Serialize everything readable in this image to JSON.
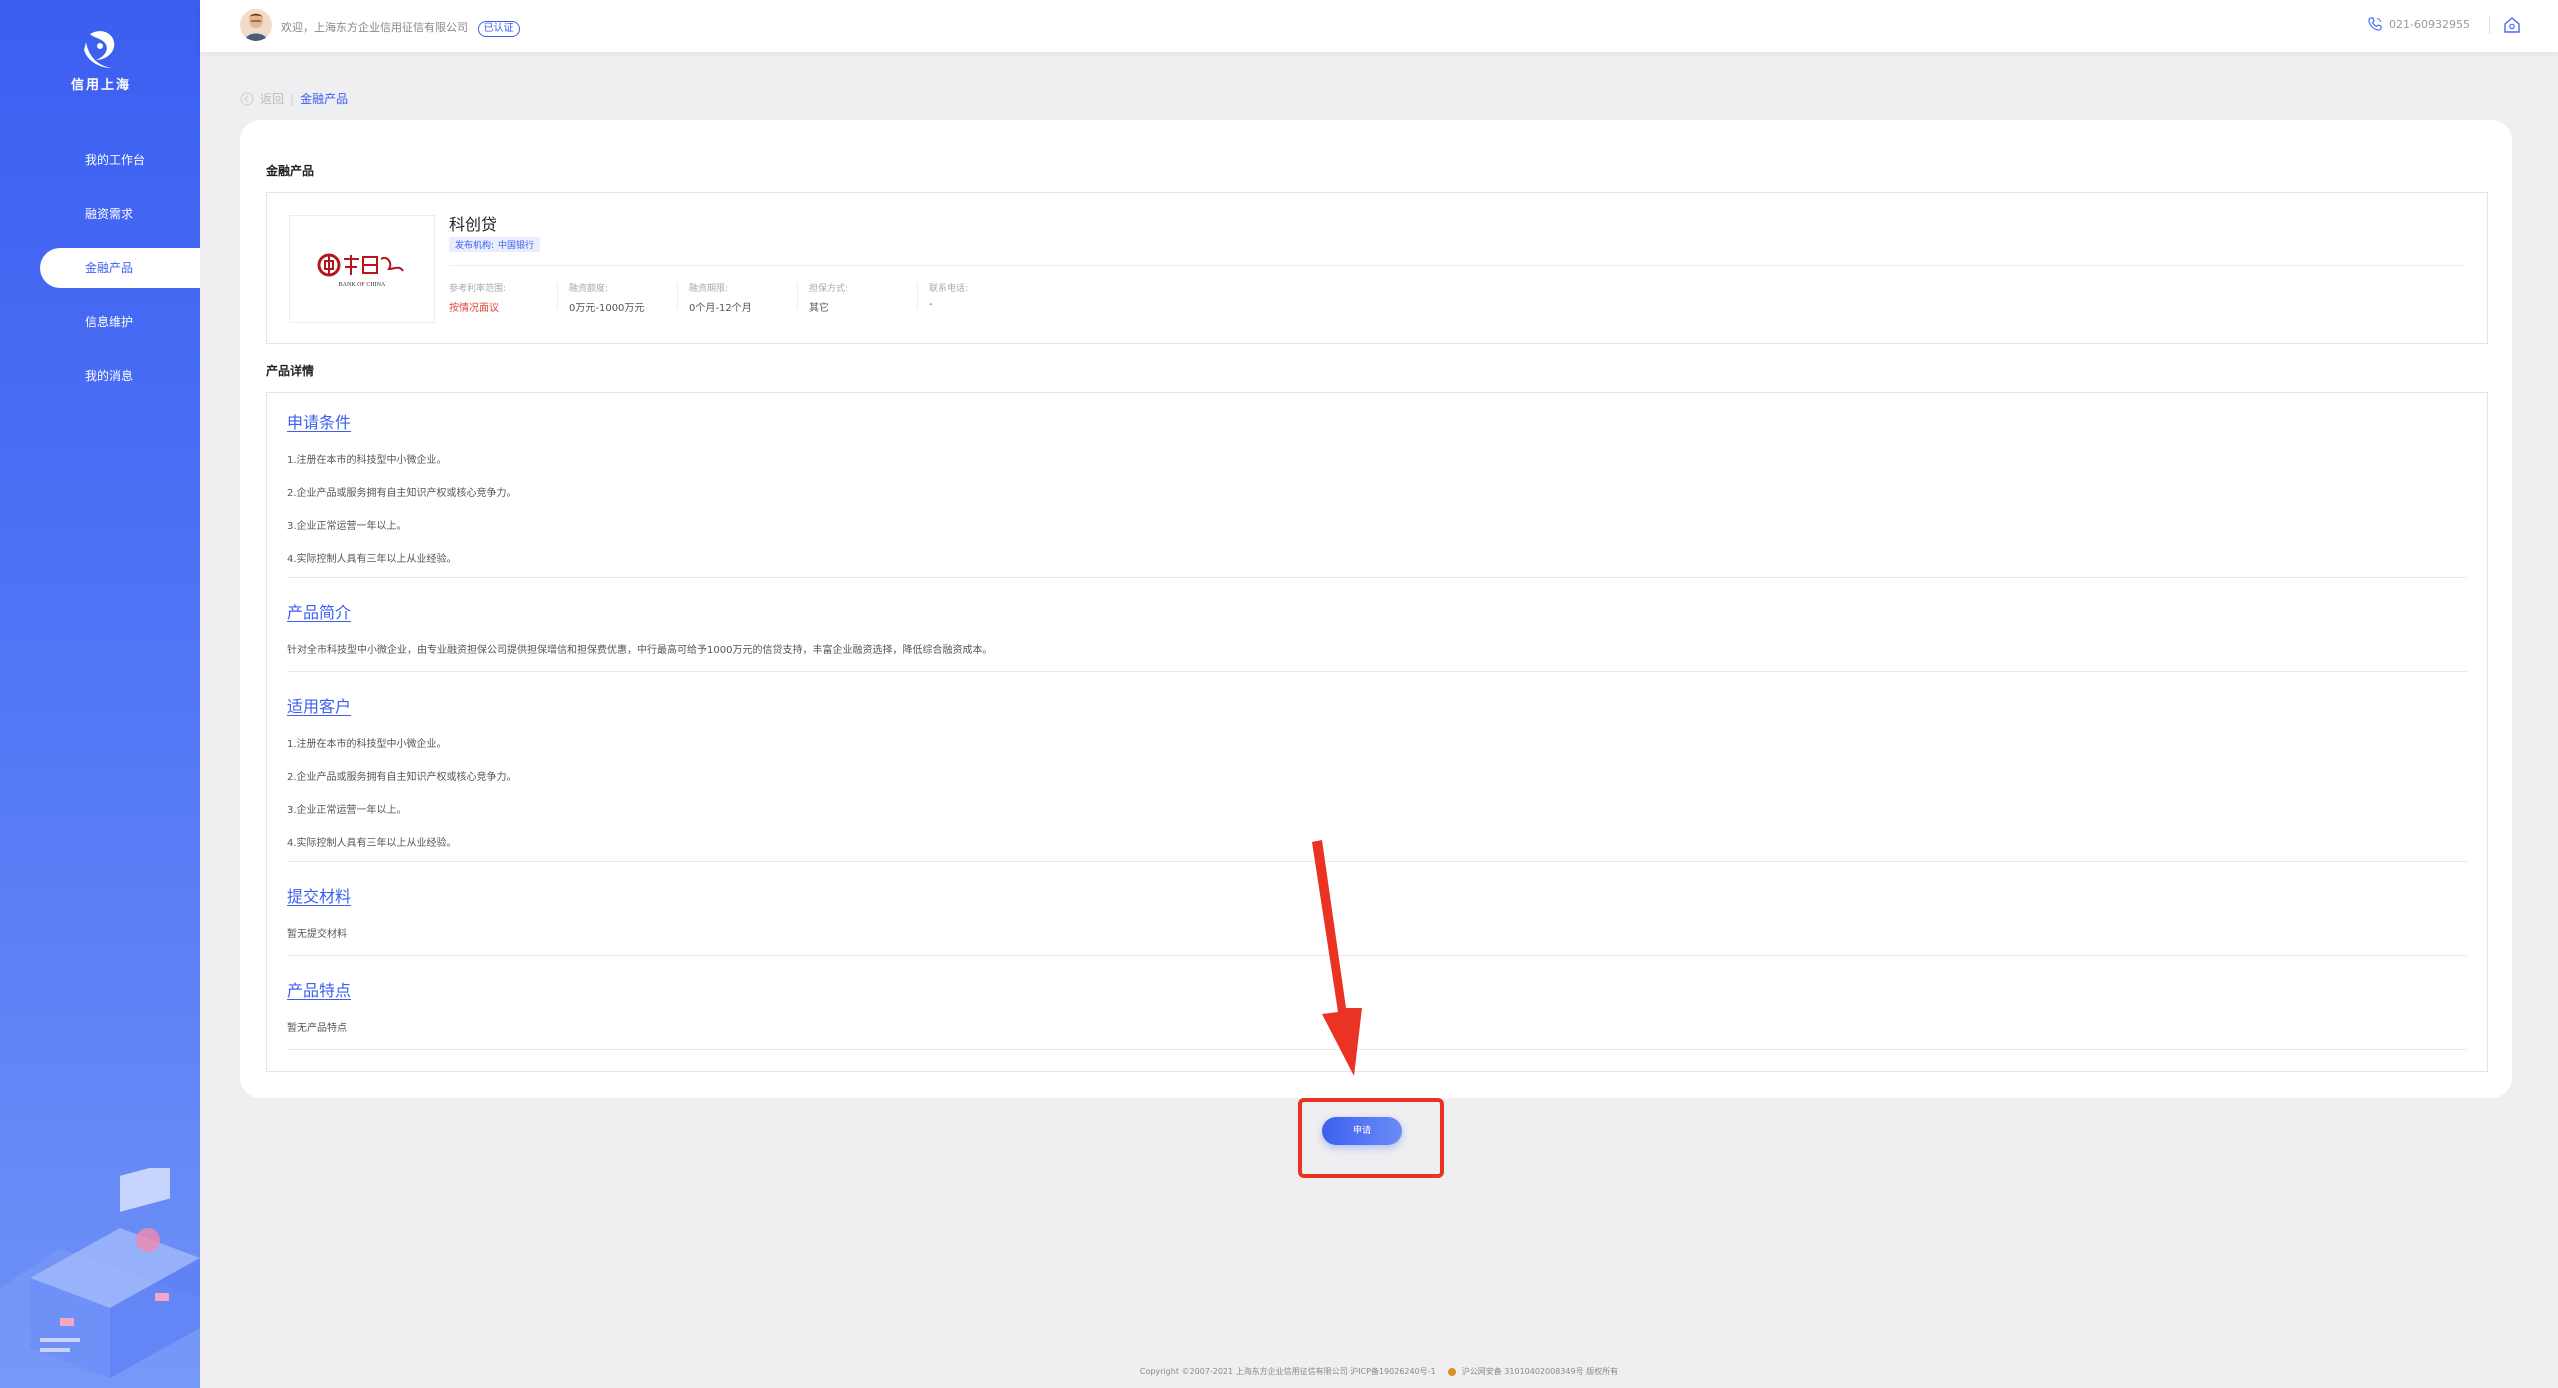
{
  "sidebar": {
    "logo_text": "信用上海",
    "items": [
      {
        "label": "我的工作台"
      },
      {
        "label": "融资需求"
      },
      {
        "label": "金融产品"
      },
      {
        "label": "信息维护"
      },
      {
        "label": "我的消息"
      }
    ]
  },
  "topbar": {
    "welcome": "欢迎，上海东方企业信用征信有限公司",
    "verify_badge": "已认证",
    "phone": "021-60932955"
  },
  "breadcrumb": {
    "back": "返回",
    "current": "金融产品"
  },
  "product": {
    "section_title": "金融产品",
    "name": "科创贷",
    "publisher_label": "发布机构:",
    "publisher": "中国银行",
    "bank_logo_text": "BANK OF CHINA",
    "meta": [
      {
        "label": "参考利率范围:",
        "value": "按情况面议"
      },
      {
        "label": "融资额度:",
        "value": "0万元-1000万元"
      },
      {
        "label": "融资期限:",
        "value": "0个月-12个月"
      },
      {
        "label": "担保方式:",
        "value": "其它"
      },
      {
        "label": "联系电话:",
        "value": "-"
      }
    ]
  },
  "details": {
    "section_title": "产品详情",
    "sections": [
      {
        "heading": "申请条件",
        "lines": [
          "1.注册在本市的科技型中小微企业。",
          "2.企业产品或服务拥有自主知识产权或核心竞争力。",
          "3.企业正常运营一年以上。",
          "4.实际控制人具有三年以上从业经验。"
        ]
      },
      {
        "heading": "产品简介",
        "lines": [
          "针对全市科技型中小微企业，由专业融资担保公司提供担保增信和担保费优惠，中行最高可给予1000万元的信贷支持，丰富企业融资选择，降低综合融资成本。"
        ]
      },
      {
        "heading": "适用客户",
        "lines": [
          "1.注册在本市的科技型中小微企业。",
          "2.企业产品或服务拥有自主知识产权或核心竞争力。",
          "3.企业正常运营一年以上。",
          "4.实际控制人具有三年以上从业经验。"
        ]
      },
      {
        "heading": "提交材料",
        "lines": [
          "暂无提交材料"
        ]
      },
      {
        "heading": "产品特点",
        "lines": [
          "暂无产品特点"
        ]
      }
    ]
  },
  "apply_button": "申请",
  "footer": {
    "copyright": "Copyright ©2007-2021 上海东方企业信用征信有限公司 沪ICP备19026240号-1",
    "police": "沪公网安备 31010402008349号 版权所有"
  },
  "colors": {
    "accent": "#3d5ff0",
    "annotation_red": "#ea3323"
  }
}
